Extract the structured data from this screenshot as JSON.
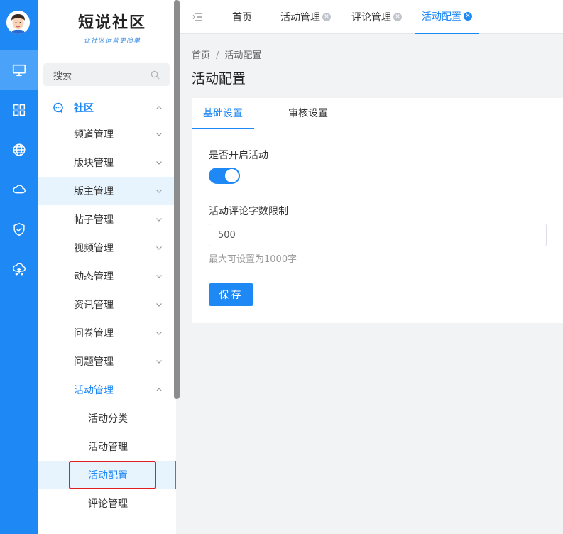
{
  "colors": {
    "primary": "#1e88f5",
    "rail_active": "#4aa3f9",
    "selected_bg": "#e8f4fd",
    "highlight_box": "#e02020"
  },
  "rail": {
    "icons": [
      "monitor-icon",
      "grid-icon",
      "globe-icon",
      "cloud-icon",
      "shield-check-icon",
      "cloud-network-icon"
    ],
    "active_index": 0
  },
  "logo": {
    "title": "短说社区",
    "subtitle": "让社区运营更简单"
  },
  "search": {
    "placeholder": "搜索"
  },
  "sidebar": {
    "section_label": "社区",
    "items": [
      "频道管理",
      "版块管理",
      "版主管理",
      "帖子管理",
      "视频管理",
      "动态管理",
      "资讯管理",
      "问卷管理",
      "问题管理",
      "活动管理"
    ],
    "sub_items": [
      "活动分类",
      "活动管理",
      "活动配置",
      "评论管理"
    ],
    "selected_sub": "活动配置"
  },
  "tabs": [
    {
      "label": "首页",
      "closable": false
    },
    {
      "label": "活动管理",
      "closable": true
    },
    {
      "label": "评论管理",
      "closable": true
    },
    {
      "label": "活动配置",
      "closable": true,
      "active": true
    }
  ],
  "breadcrumb": {
    "home": "首页",
    "current": "活动配置"
  },
  "page_title": "活动配置",
  "content_tabs": [
    "基础设置",
    "审核设置"
  ],
  "form": {
    "enable_label": "是否开启活动",
    "enable_value": true,
    "limit_label": "活动评论字数限制",
    "limit_value": "500",
    "limit_hint": "最大可设置为1000字",
    "save_label": "保存"
  }
}
